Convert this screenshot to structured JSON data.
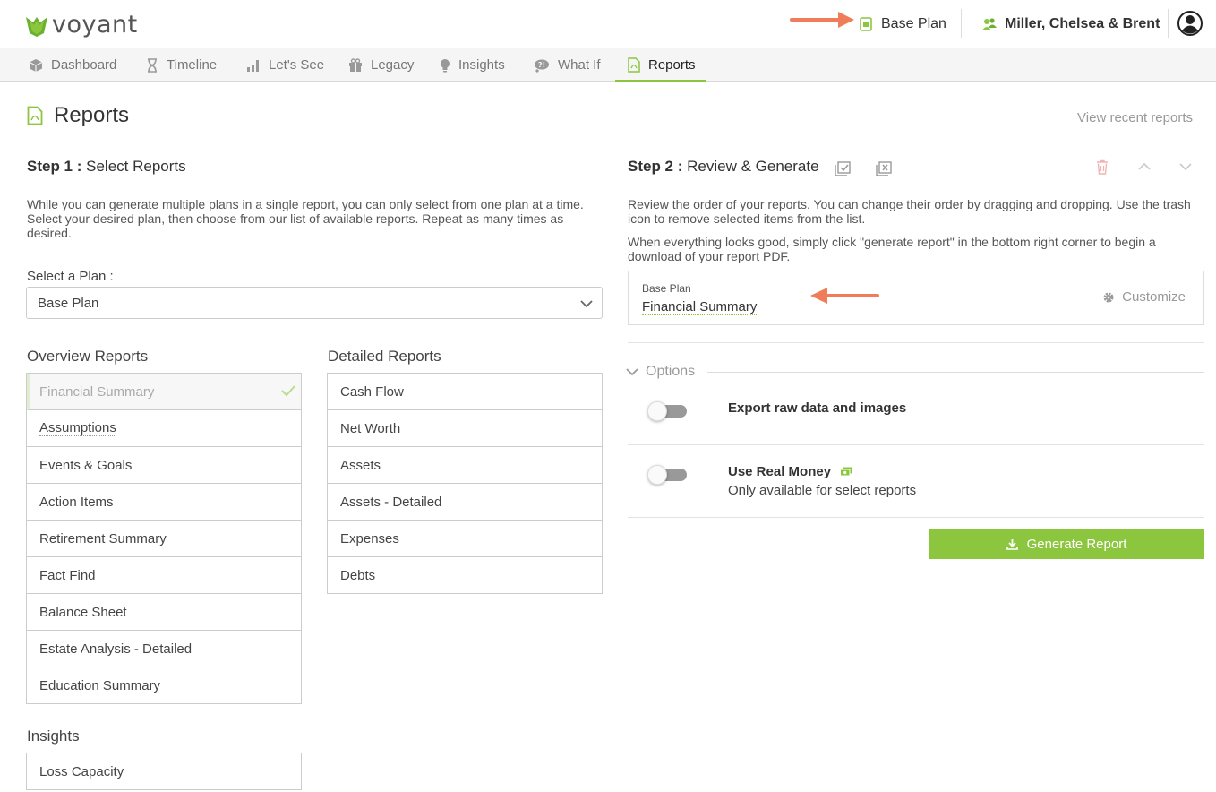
{
  "header": {
    "logo_text": "voyant",
    "plan_name": "Base Plan",
    "client_name": "Miller, Chelsea & Brent"
  },
  "nav": {
    "tabs": [
      {
        "label": "Dashboard",
        "icon": "cube-icon"
      },
      {
        "label": "Timeline",
        "icon": "hourglass-icon"
      },
      {
        "label": "Let's See",
        "icon": "bar-chart-icon"
      },
      {
        "label": "Legacy",
        "icon": "gift-icon"
      },
      {
        "label": "Insights",
        "icon": "lightbulb-icon"
      },
      {
        "label": "What If",
        "icon": "thought-bubble-icon"
      },
      {
        "label": "Reports",
        "icon": "pdf-file-icon",
        "active": true
      }
    ]
  },
  "page": {
    "title": "Reports",
    "view_recent": "View recent reports"
  },
  "step1": {
    "prefix": "Step 1 :",
    "title": "Select Reports",
    "description": "While you can generate multiple plans in a single report, you can only select from one plan at a time. Select your desired plan, then choose from our list of available reports. Repeat as many times as desired.",
    "select_label": "Select a Plan :",
    "selected_plan": "Base Plan",
    "overview_heading": "Overview Reports",
    "overview_reports": [
      "Financial Summary",
      "Assumptions",
      "Events & Goals",
      "Action Items",
      "Retirement Summary",
      "Fact Find",
      "Balance Sheet",
      "Estate Analysis - Detailed",
      "Education Summary"
    ],
    "detailed_heading": "Detailed Reports",
    "detailed_reports": [
      "Cash Flow",
      "Net Worth",
      "Assets",
      "Assets - Detailed",
      "Expenses",
      "Debts"
    ],
    "insights_heading": "Insights",
    "insights_reports": [
      "Loss Capacity"
    ]
  },
  "step2": {
    "prefix": "Step 2 :",
    "title": "Review & Generate",
    "description1": "Review the order of your reports. You can change their order by dragging and dropping. Use the trash icon to remove selected items from the list.",
    "description2": "When everything looks good, simply click \"generate report\" in the bottom right corner to begin a download of your report PDF.",
    "queue_item": {
      "plan": "Base Plan",
      "report": "Financial Summary",
      "customize": "Customize"
    },
    "options_label": "Options",
    "option1_title": "Export raw data and images",
    "option2_title": "Use Real Money",
    "option2_sub": "Only available for select reports",
    "generate_label": "Generate Report"
  },
  "colors": {
    "accent": "#8cc63f",
    "annotation_arrow": "#ef7d5a"
  }
}
